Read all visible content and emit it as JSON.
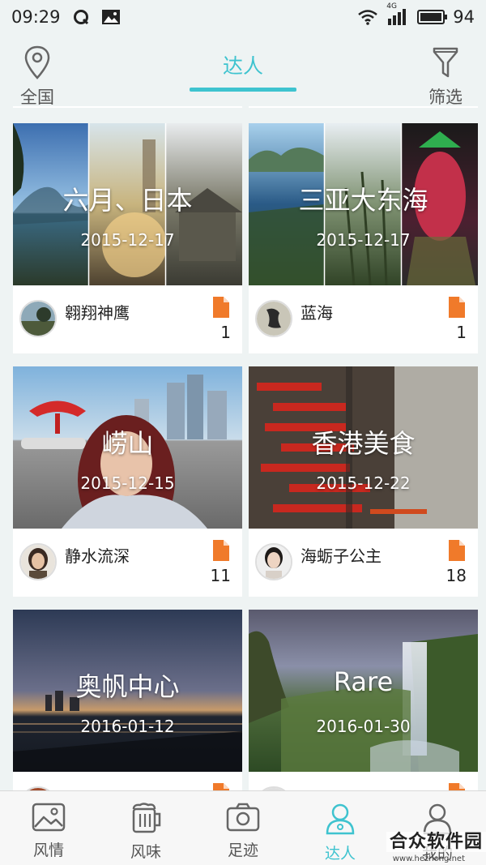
{
  "status_bar": {
    "time": "09:29",
    "network": "4G",
    "battery": "94"
  },
  "header": {
    "location_label": "全国",
    "tab_label": "达人",
    "filter_label": "筛选"
  },
  "cards": [
    {
      "title": "六月、日本",
      "date": "2015-12-17",
      "author": "翱翔神鹰",
      "count": "1"
    },
    {
      "title": "三亚大东海",
      "date": "2015-12-17",
      "author": "蓝海",
      "count": "1"
    },
    {
      "title": "崂山",
      "date": "2015-12-15",
      "author": "静水流深",
      "count": "11"
    },
    {
      "title": "香港美食",
      "date": "2015-12-22",
      "author": "海蛎子公主",
      "count": "18"
    },
    {
      "title": "奥帆中心",
      "date": "2016-01-12",
      "author": "",
      "count": ""
    },
    {
      "title": "Rare",
      "date": "2016-01-30",
      "author": "",
      "count": ""
    }
  ],
  "bottom_nav": [
    {
      "label": "风情",
      "icon": "image-icon"
    },
    {
      "label": "风味",
      "icon": "beer-icon"
    },
    {
      "label": "足迹",
      "icon": "camera-icon"
    },
    {
      "label": "达人",
      "icon": "person-icon"
    },
    {
      "label": "我的",
      "icon": "user-icon"
    }
  ],
  "watermark": {
    "title": "合众软件园",
    "url": "www.hezhong.net"
  },
  "colors": {
    "accent": "#3ec3cf",
    "doc": "#f07a2a"
  }
}
